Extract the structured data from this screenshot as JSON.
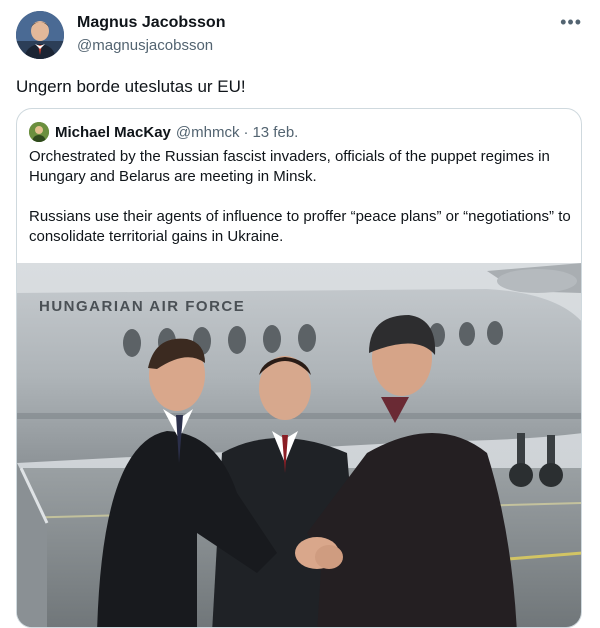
{
  "author": {
    "name": "Magnus Jacobsson",
    "handle": "@magnusjacobsson"
  },
  "tweet": {
    "text": "Ungern borde uteslutas ur EU!"
  },
  "more_icon": "more-horizontal-icon",
  "quote": {
    "name": "Michael MacKay",
    "handle": "@mhmck",
    "separator": "·",
    "date": "13 feb.",
    "paragraphs": [
      "Orchestrated by the Russian fascist invaders, officials of the puppet regimes in Hungary and Belarus are meeting in Minsk.",
      "Russians use their agents of influence to proffer “peace plans” or “negotiations” to consolidate territorial gains in Ukraine."
    ],
    "image": {
      "aircraft_lettering": "HUNGARIAN AIR FORCE"
    }
  },
  "colors": {
    "text_primary": "#0f1419",
    "text_secondary": "#536471",
    "border": "#cfd9de"
  }
}
